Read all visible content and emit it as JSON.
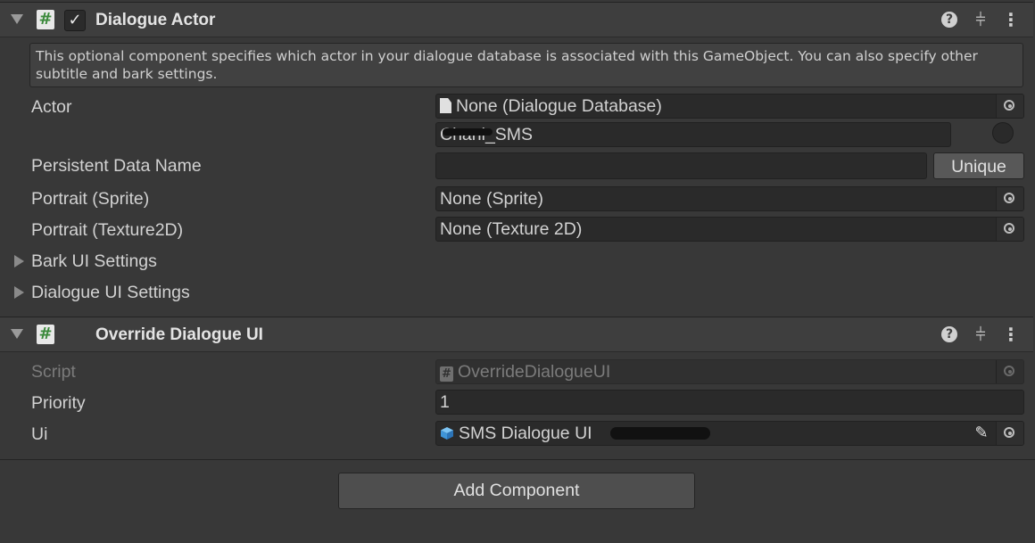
{
  "dialogue_actor": {
    "title": "Dialogue Actor",
    "enabled_check": "✓",
    "help_text": "This optional component specifies which actor in your dialogue database is associated with this GameObject. You can also specify other subtitle and bark settings.",
    "actor": {
      "label": "Actor",
      "database_value": "None (Dialogue Database)",
      "actor_name": "Chani_SMS"
    },
    "persistent_data_name": {
      "label": "Persistent Data Name",
      "value": "",
      "unique_button": "Unique"
    },
    "portrait_sprite": {
      "label": "Portrait (Sprite)",
      "value": "None (Sprite)"
    },
    "portrait_texture": {
      "label": "Portrait (Texture2D)",
      "value": "None (Texture 2D)"
    },
    "bark_ui_settings": "Bark UI Settings",
    "dialogue_ui_settings": "Dialogue UI Settings"
  },
  "override_dialogue_ui": {
    "title": "Override Dialogue UI",
    "script": {
      "label": "Script",
      "value": "OverrideDialogueUI"
    },
    "priority": {
      "label": "Priority",
      "value": "1"
    },
    "ui": {
      "label": "Ui",
      "value": "SMS Dialogue UI"
    }
  },
  "header_icons": {
    "help": "?",
    "presets": "⫩",
    "menu": "⋮"
  },
  "add_component_button": "Add Component",
  "colors": {
    "background": "#383838",
    "header": "#3e3e3e",
    "field": "#2a2a2a",
    "script_icon_green": "#3c8a3c",
    "prefab_blue": "#4aa3e8"
  }
}
